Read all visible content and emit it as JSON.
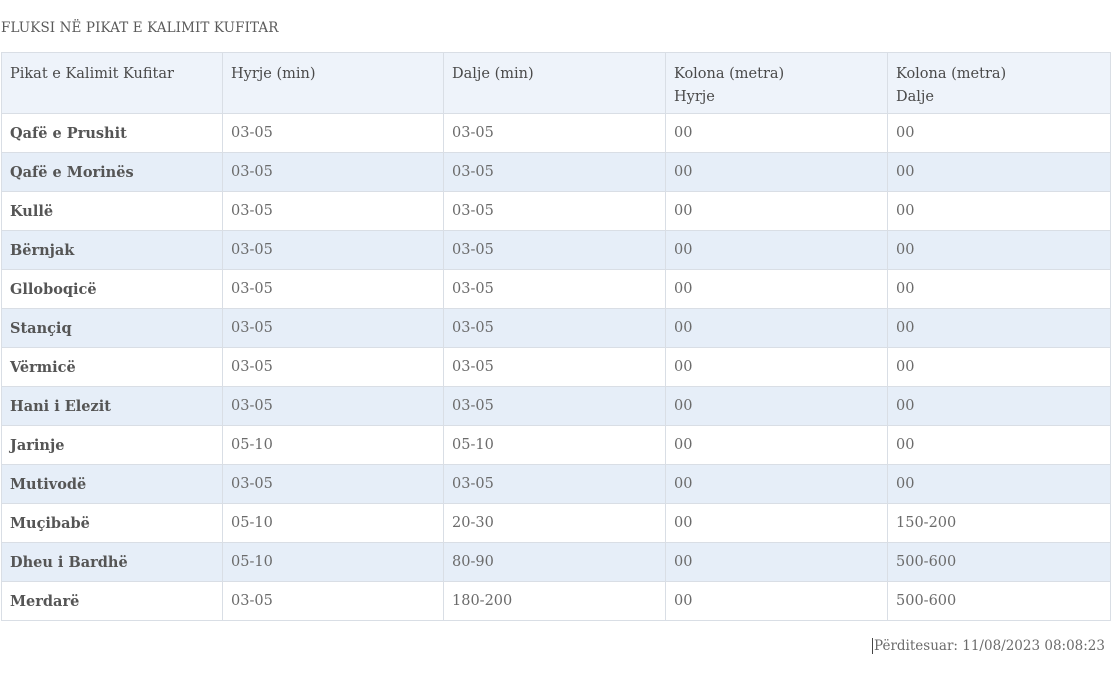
{
  "page": {
    "title": "FLUKSI NË PIKAT E KALIMIT KUFITAR",
    "updated": "Përditesuar: 11/08/2023 08:08:23"
  },
  "table": {
    "headers": [
      [
        "Pikat e Kalimit Kufitar"
      ],
      [
        "Hyrje (min)"
      ],
      [
        "Dalje (min)"
      ],
      [
        "Kolona (metra)",
        "Hyrje"
      ],
      [
        "Kolona (metra)",
        "Dalje"
      ]
    ],
    "rows": [
      [
        "Qafë e Prushit",
        "03-05",
        "03-05",
        "00",
        "00"
      ],
      [
        "Qafë e Morinës",
        "03-05",
        "03-05",
        "00",
        "00"
      ],
      [
        "Kullë",
        "03-05",
        "03-05",
        "00",
        "00"
      ],
      [
        "Bërnjak",
        "03-05",
        "03-05",
        "00",
        "00"
      ],
      [
        "Glloboqicë",
        "03-05",
        "03-05",
        "00",
        "00"
      ],
      [
        "Stançiq",
        "03-05",
        "03-05",
        "00",
        "00"
      ],
      [
        "Vërmicë",
        "03-05",
        "03-05",
        "00",
        "00"
      ],
      [
        "Hani i Elezit",
        "03-05",
        "03-05",
        "00",
        "00"
      ],
      [
        "Jarinje",
        "05-10",
        "05-10",
        "00",
        "00"
      ],
      [
        "Mutivodë",
        "03-05",
        "03-05",
        "00",
        "00"
      ],
      [
        "Muçibabë",
        "05-10",
        "20-30",
        "00",
        "150-200"
      ],
      [
        "Dheu i Bardhë",
        "05-10",
        "80-90",
        "00",
        "500-600"
      ],
      [
        "Merdarë",
        "03-05",
        "180-200",
        "00",
        "500-600"
      ]
    ]
  }
}
